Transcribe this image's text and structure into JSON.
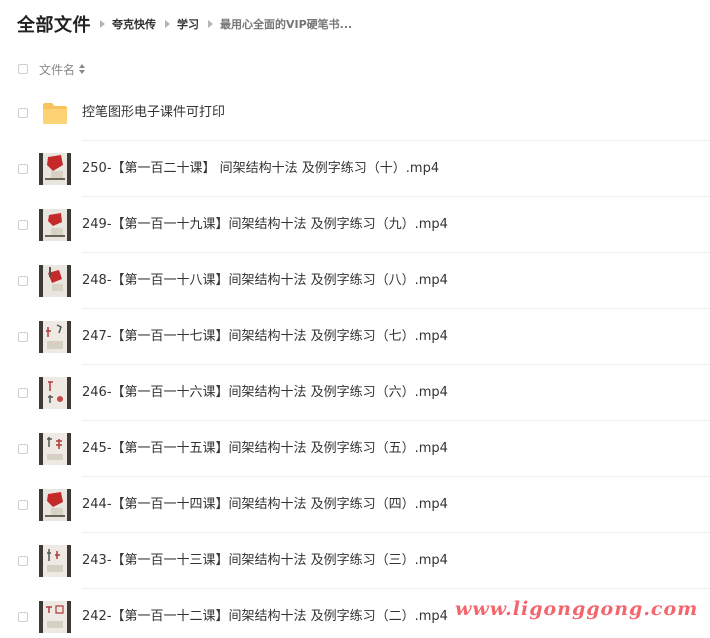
{
  "breadcrumb": {
    "root": "全部文件",
    "items": [
      "夸克快传",
      "学习",
      "最用心全面的VIP硬笔书..."
    ]
  },
  "list_header": {
    "name_column": "文件名"
  },
  "files": [
    {
      "name": "控笔图形电子课件可打印",
      "type": "folder",
      "icon": "folder-icon"
    },
    {
      "name": "250-【第一百二十课】 间架结构十法 及例字练习（十）.mp4",
      "type": "video",
      "icon": "video-thumbnail"
    },
    {
      "name": "249-【第一百一十九课】间架结构十法 及例字练习（九）.mp4",
      "type": "video",
      "icon": "video-thumbnail"
    },
    {
      "name": "248-【第一百一十八课】间架结构十法 及例字练习（八）.mp4",
      "type": "video",
      "icon": "video-thumbnail"
    },
    {
      "name": "247-【第一百一十七课】间架结构十法 及例字练习（七）.mp4",
      "type": "video",
      "icon": "video-thumbnail"
    },
    {
      "name": "246-【第一百一十六课】间架结构十法 及例字练习（六）.mp4",
      "type": "video",
      "icon": "video-thumbnail"
    },
    {
      "name": "245-【第一百一十五课】间架结构十法 及例字练习（五）.mp4",
      "type": "video",
      "icon": "video-thumbnail"
    },
    {
      "name": "244-【第一百一十四课】间架结构十法 及例字练习（四）.mp4",
      "type": "video",
      "icon": "video-thumbnail"
    },
    {
      "name": "243-【第一百一十三课】间架结构十法 及例字练习（三）.mp4",
      "type": "video",
      "icon": "video-thumbnail"
    },
    {
      "name": "242-【第一百一十二课】间架结构十法 及例字练习（二）.mp4",
      "type": "video",
      "icon": "video-thumbnail"
    }
  ],
  "watermark": "www.ligonggong.com",
  "colors": {
    "folder": "#f7c35c",
    "watermark": "#f3666e",
    "divider": "#eeeeee"
  }
}
